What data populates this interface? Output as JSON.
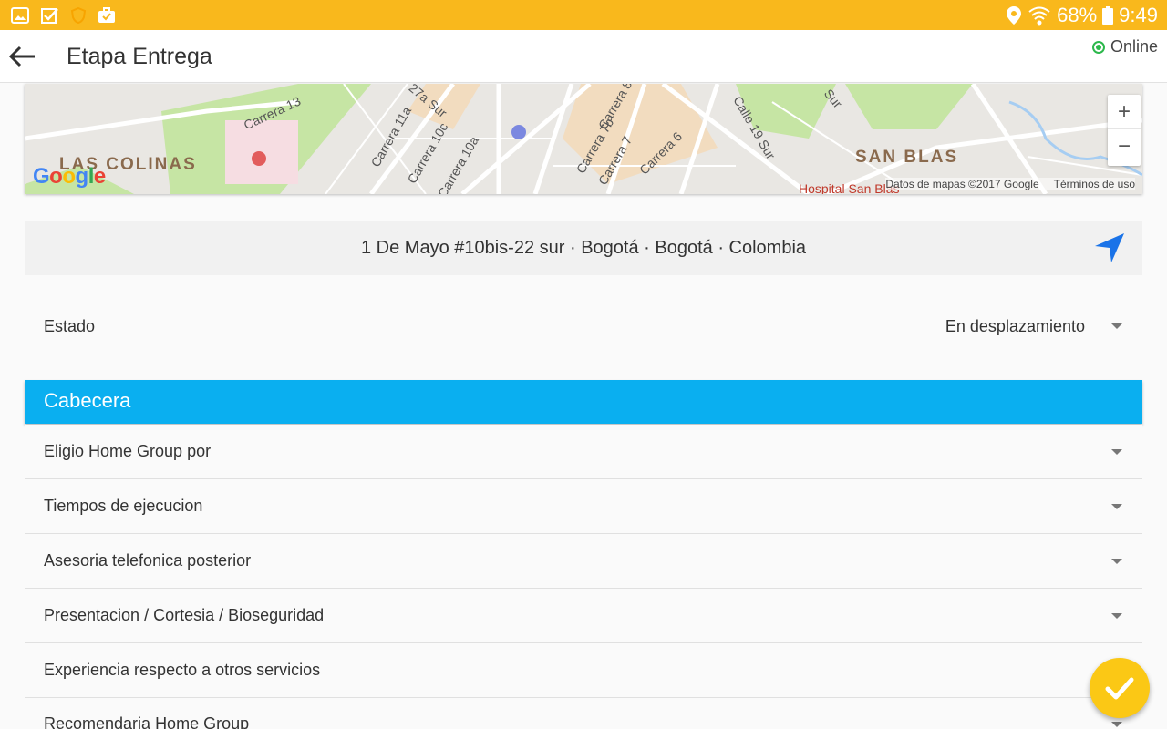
{
  "status_bar": {
    "battery_percent": "68%",
    "time": "9:49",
    "icons": [
      "gallery-icon",
      "check-box-icon",
      "shield-icon",
      "briefcase-check-icon",
      "location-icon",
      "wifi-icon",
      "battery-icon"
    ]
  },
  "app_bar": {
    "title": "Etapa Entrega",
    "online_label": "Online",
    "online_color": "#2db84c"
  },
  "map": {
    "labels": {
      "las_colinas": "LAS COLINAS",
      "san_blas": "SAN BLAS",
      "carrera_13": "Carrera 13",
      "carrera_11a": "Carrera 11a",
      "carrera_10c": "Carrera 10c",
      "carrera_10a": "Carrera 10a",
      "carrera_8": "Carrera 8",
      "carrera_7b": "Carrera 7b",
      "carrera_7": "Carrera 7",
      "carrera_6": "Carrera 6",
      "calle_19_sur": "Calle 19 Sur",
      "calle_27a_sur": "27a Sur",
      "sur_label": "Sur",
      "hospital": "Hospital San Blas"
    },
    "credit": "Datos de mapas ©2017 Google",
    "terms": "Términos de uso",
    "zoom_in": "+",
    "zoom_out": "−",
    "logo": [
      "G",
      "o",
      "o",
      "g",
      "l",
      "e"
    ]
  },
  "address": {
    "text": "1 De Mayo #10bis-22 sur · Bogotá · Bogotá · Colombia"
  },
  "estado": {
    "label": "Estado",
    "value": "En desplazamiento"
  },
  "section": {
    "title": "Cabecera"
  },
  "items": [
    {
      "label": "Eligio Home Group por"
    },
    {
      "label": "Tiempos de ejecucion"
    },
    {
      "label": "Asesoria telefonica posterior"
    },
    {
      "label": "Presentacion / Cortesia / Bioseguridad"
    },
    {
      "label": "Experiencia respecto a otros servicios"
    },
    {
      "label": "Recomendaria Home Group"
    }
  ],
  "colors": {
    "status_bar": "#f9b81c",
    "section_header": "#0aaff0",
    "fab": "#fbc815",
    "nav_icon": "#1a73e8"
  }
}
